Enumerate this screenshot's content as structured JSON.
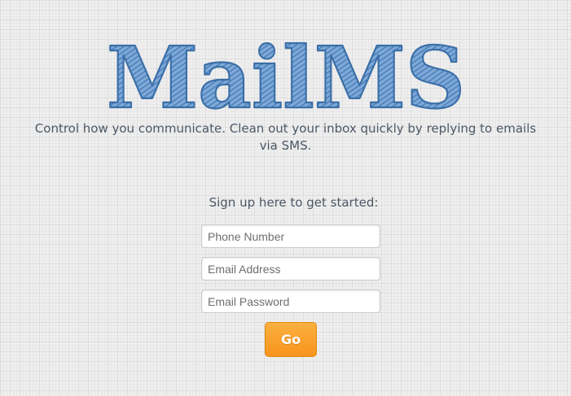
{
  "brand": {
    "logo_text": "MailMS",
    "color": "#4a86c5"
  },
  "tagline": "Control how you communicate. Clean out your inbox quickly by replying to emails via SMS.",
  "signup": {
    "heading": "Sign up here to get started:",
    "phone_placeholder": "Phone Number",
    "email_placeholder": "Email Address",
    "password_placeholder": "Email Password",
    "submit_label": "Go",
    "submit_color": "#f7941d"
  }
}
